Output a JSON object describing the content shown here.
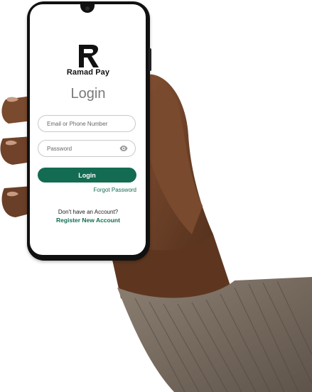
{
  "brand": {
    "name": "Ramad Pay",
    "logo_letter": "R",
    "accent": "#136b52",
    "logo_color": "#111111"
  },
  "login": {
    "title": "Login",
    "email_placeholder": "Email or Phone Number",
    "email_value": "",
    "password_placeholder": "Password",
    "password_value": "",
    "password_toggle_icon": "eye-icon",
    "submit_label": "Login",
    "forgot_label": "Forgot Password",
    "no_account_text": "Don't have an Account?",
    "register_label": "Register New Account"
  },
  "colors": {
    "page_bg": "#ffffff",
    "phone_body": "#111111",
    "skin": "#6b3f25",
    "sleeve": "#77685b"
  }
}
